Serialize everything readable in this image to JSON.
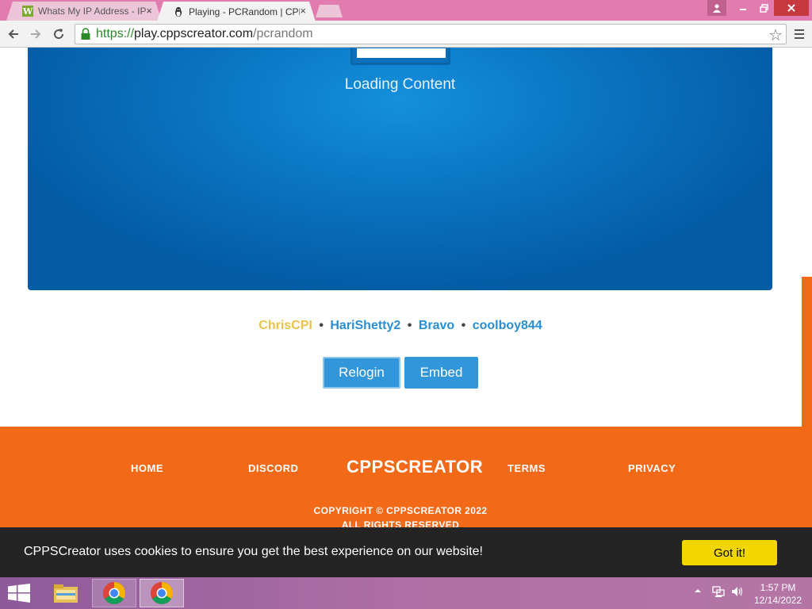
{
  "browser": {
    "tabs": [
      {
        "title": "Whats My IP Address - IP",
        "favicon": "w-favicon-icon",
        "active": false
      },
      {
        "title": "Playing - PCRandom | CPP",
        "favicon": "penguin-favicon-icon",
        "active": true
      }
    ],
    "tab_close_glyph": "×",
    "url": {
      "scheme": "https://",
      "host": "play.cppscreator.com",
      "path": "/pcrandom"
    }
  },
  "game": {
    "loading_text": "Loading Content"
  },
  "credits": [
    {
      "name": "ChrisCPI",
      "color": "#e9c34a"
    },
    {
      "name": "HariShetty2",
      "color": "#2a8ed2"
    },
    {
      "name": "Bravo",
      "color": "#2a8ed2"
    },
    {
      "name": "coolboy844",
      "color": "#2a8ed2"
    }
  ],
  "credit_separator": "•",
  "actions": {
    "relogin": "Relogin",
    "embed": "Embed"
  },
  "footer": {
    "links": {
      "home": "HOME",
      "discord": "DISCORD",
      "terms": "TERMS",
      "privacy": "PRIVACY"
    },
    "brand": "CPPSCREATOR",
    "copyright_line1": "COPYRIGHT © CPPSCREATOR 2022",
    "copyright_line2": "ALL RIGHTS RESERVED"
  },
  "cookie_banner": {
    "text": "CPPSCreator uses cookies to ensure you get the best experience on our website!",
    "button": "Got it!"
  },
  "taskbar": {
    "time": "1:57 PM",
    "date": "12/14/2022"
  },
  "colors": {
    "accent_orange": "#f26a18",
    "button_blue": "#3296db",
    "cookie_yellow": "#f1d600",
    "game_blue": "#0a76c4"
  }
}
